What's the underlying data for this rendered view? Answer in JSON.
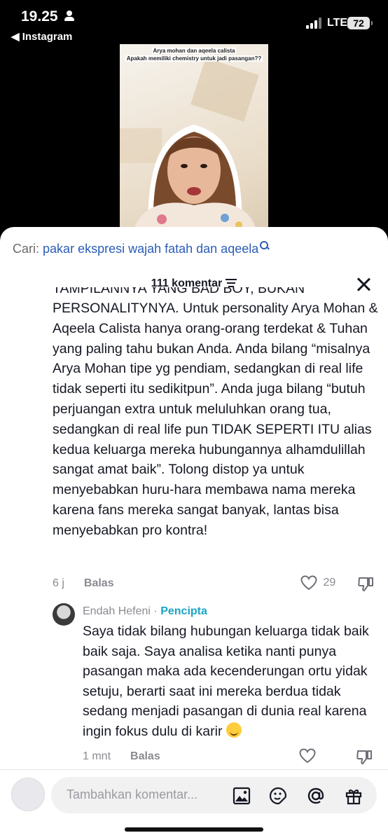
{
  "status_bar": {
    "time": "19.25",
    "back_app": "◀ Instagram",
    "network": "LTE",
    "battery": "72"
  },
  "video": {
    "caption_line1": "Arya mohan dan aqeela calista",
    "caption_line2": "Apakah memiliki chemistry untuk jadi pasangan??"
  },
  "search": {
    "prefix": "Cari:",
    "query": "pakar ekspresi wajah fatah dan aqeela"
  },
  "header": {
    "comment_count": "111 komentar"
  },
  "comments": [
    {
      "text_cut": "TAMPILANNYA YANG BAD BOY, BUKAN",
      "text": "PERSONALITYNYA. Untuk personality Arya Mohan & Aqeela Calista hanya orang-orang terdekat & Tuhan yang paling tahu bukan Anda. Anda bilang “misalnya Arya Mohan tipe yg pendiam, sedangkan di real life tidak seperti itu sedikitpun”. Anda juga bilang “butuh perjuangan extra untuk meluluhkan orang tua, sedangkan di real life pun TIDAK SEPERTI ITU alias kedua keluarga mereka hubungannya alhamdulillah sangat amat baik”. Tolong distop ya untuk menyebabkan huru-hara membawa nama mereka karena fans mereka sangat banyak, lantas bisa menyebabkan pro kontra!",
      "time": "6 j",
      "reply_label": "Balas",
      "likes": "29"
    }
  ],
  "reply": {
    "author": "Endah Hefeni",
    "separator": "·",
    "badge": "Pencipta",
    "text": "Saya tidak bilang hubungan keluarga tidak baik baik saja. Saya analisa ketika nanti punya pasangan maka ada kecenderungan ortu yidak setuju, berarti saat ini mereka berdua tidak sedang menjadi pasangan di dunia real karena ingin fokus dulu di karir",
    "time": "1 mnt",
    "reply_label": "Balas"
  },
  "composer": {
    "placeholder": "Tambahkan komentar..."
  },
  "colors": {
    "link_blue": "#2b5db8",
    "creator_teal": "#1ba3c1",
    "muted": "#8a8b91"
  },
  "icons": [
    "person-icon",
    "signal-icon",
    "battery-icon",
    "search-icon",
    "filter-icon",
    "close-icon",
    "heart-icon",
    "dislike-icon",
    "image-icon",
    "sticker-icon",
    "mention-icon",
    "gift-icon",
    "smile-emoji"
  ]
}
